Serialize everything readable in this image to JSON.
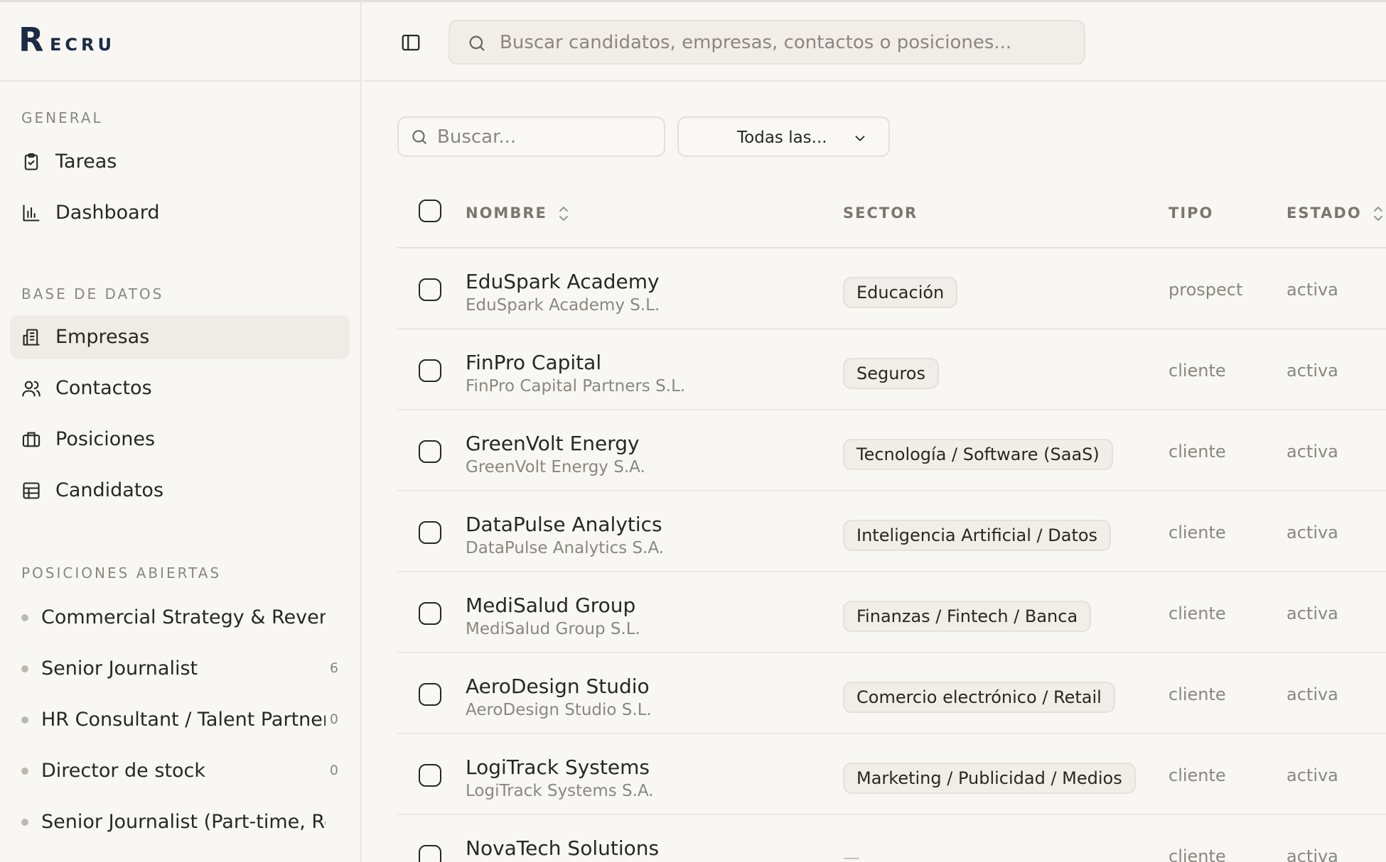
{
  "app": {
    "logo_initial": "R",
    "logo_rest": "ECRU"
  },
  "sidebar": {
    "sections": {
      "general": "GENERAL",
      "database": "BASE DE DATOS",
      "open_positions": "POSICIONES ABIERTAS"
    },
    "general_items": [
      {
        "label": "Tareas",
        "icon": "clipboard-check-icon"
      },
      {
        "label": "Dashboard",
        "icon": "bar-chart-icon"
      }
    ],
    "database_items": [
      {
        "label": "Empresas",
        "icon": "building-icon",
        "active": true
      },
      {
        "label": "Contactos",
        "icon": "users-icon"
      },
      {
        "label": "Posiciones",
        "icon": "briefcase-icon"
      },
      {
        "label": "Candidatos",
        "icon": "table-icon"
      }
    ],
    "positions": [
      {
        "label": "Commercial Strategy & Revenue (",
        "count": ""
      },
      {
        "label": "Senior Journalist",
        "count": "6"
      },
      {
        "label": "HR Consultant / Talent Partner",
        "count": "0"
      },
      {
        "label": "Director de stock",
        "count": "0"
      },
      {
        "label": "Senior Journalist (Part-time, Remo",
        "count": ""
      }
    ]
  },
  "header": {
    "search_placeholder": "Buscar candidatos, empresas, contactos o posiciones..."
  },
  "filters": {
    "search_placeholder": "Buscar...",
    "select_label": "Todas las..."
  },
  "table": {
    "columns": {
      "name": "NOMBRE",
      "sector": "SECTOR",
      "tipo": "TIPO",
      "estado": "ESTADO"
    },
    "rows": [
      {
        "name": "EduSpark Academy",
        "legal": "EduSpark Academy S.L.",
        "sector": "Educación",
        "tipo": "prospect",
        "estado": "activa"
      },
      {
        "name": "FinPro Capital",
        "legal": "FinPro Capital Partners S.L.",
        "sector": "Seguros",
        "tipo": "cliente",
        "estado": "activa"
      },
      {
        "name": "GreenVolt Energy",
        "legal": "GreenVolt Energy S.A.",
        "sector": "Tecnología / Software (SaaS)",
        "tipo": "cliente",
        "estado": "activa"
      },
      {
        "name": "DataPulse Analytics",
        "legal": "DataPulse Analytics S.A.",
        "sector": "Inteligencia Artificial / Datos",
        "tipo": "cliente",
        "estado": "activa"
      },
      {
        "name": "MediSalud Group",
        "legal": "MediSalud Group S.L.",
        "sector": "Finanzas / Fintech / Banca",
        "tipo": "cliente",
        "estado": "activa"
      },
      {
        "name": "AeroDesign Studio",
        "legal": "AeroDesign Studio S.L.",
        "sector": "Comercio electrónico / Retail",
        "tipo": "cliente",
        "estado": "activa"
      },
      {
        "name": "LogiTrack Systems",
        "legal": "LogiTrack Systems S.A.",
        "sector": "Marketing / Publicidad / Medios",
        "tipo": "cliente",
        "estado": "activa"
      },
      {
        "name": "NovaTech Solutions",
        "legal": "",
        "sector": "—",
        "tipo": "cliente",
        "estado": "activa"
      }
    ]
  }
}
